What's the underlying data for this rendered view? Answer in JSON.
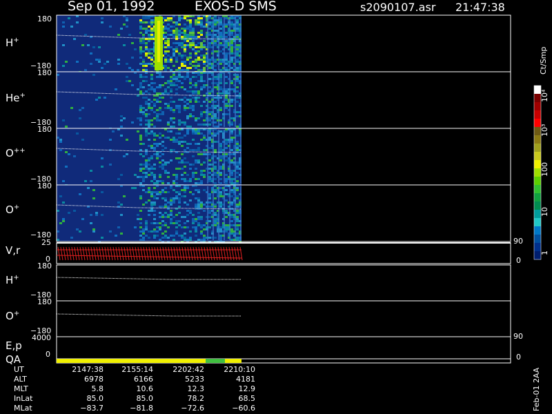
{
  "header": {
    "date": "Sep 01, 1992",
    "instrument": "EXOS-D SMS",
    "file": "s2090107.asr",
    "time": "21:47:38"
  },
  "panels": [
    {
      "name": "H",
      "sup": "+",
      "top_tick": "180",
      "bottom_tick": "−180"
    },
    {
      "name": "He",
      "sup": "+",
      "top_tick": "180",
      "bottom_tick": "−180"
    },
    {
      "name": "O",
      "sup": "++",
      "top_tick": "180",
      "bottom_tick": "−180"
    },
    {
      "name": "O",
      "sup": "+",
      "top_tick": "180",
      "bottom_tick": "−180"
    }
  ],
  "vr_panel": {
    "label": "V,r",
    "top_tick": "25",
    "bottom_tick": "0",
    "right_top": "90",
    "right_bottom": "0"
  },
  "h_panel2": {
    "name": "H",
    "sup": "+",
    "top_tick": "180",
    "bottom_tick": "−180"
  },
  "o_panel2": {
    "name": "O",
    "sup": "+",
    "top_tick": "180",
    "bottom_tick": "−180"
  },
  "ep_panel": {
    "label": "E,p",
    "tick": "4000",
    "right_top": "90",
    "right_bottom": "0"
  },
  "qa_panel": {
    "label": "QA",
    "tick": "0"
  },
  "colorbar": {
    "unit": "Ct/Smp",
    "labels": [
      "10⁴",
      "10³",
      "100",
      "10",
      "1"
    ],
    "colors": [
      "#ffffff",
      "#7a0000",
      "#a00000",
      "#c80000",
      "#ff0000",
      "#6e5a14",
      "#8c7a14",
      "#a0a01e",
      "#c8c81e",
      "#f0f000",
      "#a0e000",
      "#5cd000",
      "#30c030",
      "#10a040",
      "#008c50",
      "#009c9c",
      "#20c8c8",
      "#0078c8",
      "#0050a0",
      "#00308c",
      "#001e6e"
    ]
  },
  "footer_note": "Feb-01 2AA",
  "info_rows": [
    {
      "label": "UT",
      "values": [
        "2147:38",
        "2155:14",
        "2202:42",
        "2210:10"
      ]
    },
    {
      "label": "ALT",
      "values": [
        "6978",
        "6166",
        "5233",
        "4181"
      ]
    },
    {
      "label": "MLT",
      "values": [
        "5.8",
        "10.6",
        "12.3",
        "12.9"
      ]
    },
    {
      "label": "InLat",
      "values": [
        "85.0",
        "85.0",
        "78.2",
        "68.5"
      ]
    },
    {
      "label": "MLat",
      "values": [
        "−83.7",
        "−81.8",
        "−72.6",
        "−60.6"
      ]
    }
  ],
  "chart_data": {
    "type": "heatmap",
    "title": "Sep 01, 1992   EXOS-D SMS",
    "x": [
      "2147:38",
      "2155:14",
      "2202:42",
      "2210:10"
    ],
    "ylim": [
      -180,
      180
    ],
    "series": [
      {
        "name": "H+"
      },
      {
        "name": "He+"
      },
      {
        "name": "O++"
      },
      {
        "name": "O+"
      }
    ],
    "colorbar_range": [
      1,
      10000
    ],
    "colorbar_scale": "log"
  }
}
